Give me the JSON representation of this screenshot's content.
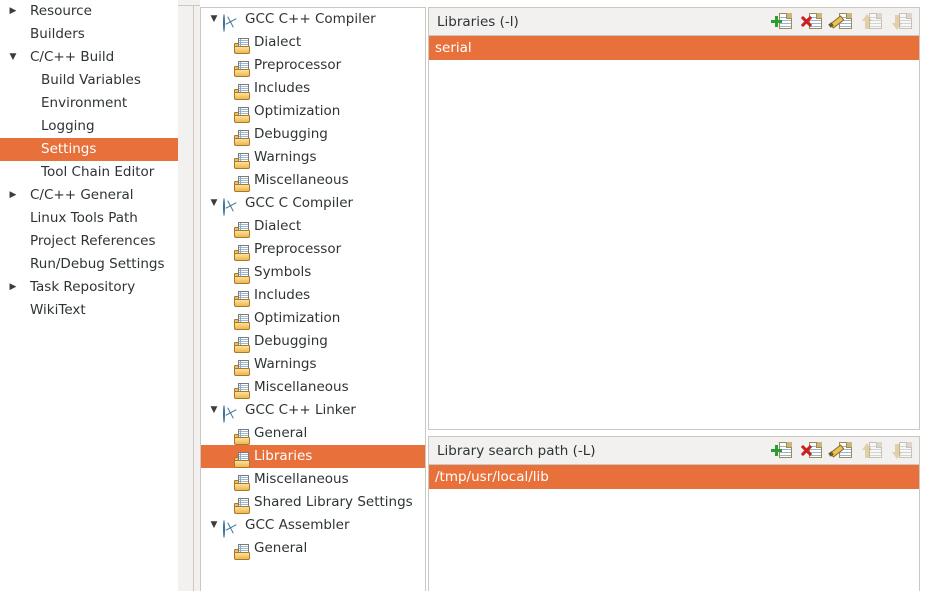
{
  "accent_color": "#e8703a",
  "sidebar": {
    "items": [
      {
        "label": "Resource",
        "level": 0,
        "arrow": "collapsed",
        "selected": false
      },
      {
        "label": "Builders",
        "level": 0,
        "arrow": "none",
        "selected": false
      },
      {
        "label": "C/C++ Build",
        "level": 0,
        "arrow": "expanded",
        "selected": false
      },
      {
        "label": "Build Variables",
        "level": 1,
        "arrow": "none",
        "selected": false
      },
      {
        "label": "Environment",
        "level": 1,
        "arrow": "none",
        "selected": false
      },
      {
        "label": "Logging",
        "level": 1,
        "arrow": "none",
        "selected": false
      },
      {
        "label": "Settings",
        "level": 1,
        "arrow": "none",
        "selected": true
      },
      {
        "label": "Tool Chain Editor",
        "level": 1,
        "arrow": "none",
        "selected": false
      },
      {
        "label": "C/C++ General",
        "level": 0,
        "arrow": "collapsed",
        "selected": false
      },
      {
        "label": "Linux Tools Path",
        "level": 0,
        "arrow": "none",
        "selected": false
      },
      {
        "label": "Project References",
        "level": 0,
        "arrow": "none",
        "selected": false
      },
      {
        "label": "Run/Debug Settings",
        "level": 0,
        "arrow": "none",
        "selected": false
      },
      {
        "label": "Task Repository",
        "level": 0,
        "arrow": "collapsed",
        "selected": false
      },
      {
        "label": "WikiText",
        "level": 0,
        "arrow": "none",
        "selected": false
      }
    ]
  },
  "tool_tree": {
    "rows": [
      {
        "label": "GCC C++ Compiler",
        "kind": "parent",
        "icon": "tool-icon",
        "selected": false
      },
      {
        "label": "Dialect",
        "kind": "child",
        "icon": "folder-icon",
        "selected": false
      },
      {
        "label": "Preprocessor",
        "kind": "child",
        "icon": "folder-icon",
        "selected": false
      },
      {
        "label": "Includes",
        "kind": "child",
        "icon": "folder-icon",
        "selected": false
      },
      {
        "label": "Optimization",
        "kind": "child",
        "icon": "folder-icon",
        "selected": false
      },
      {
        "label": "Debugging",
        "kind": "child",
        "icon": "folder-icon",
        "selected": false
      },
      {
        "label": "Warnings",
        "kind": "child",
        "icon": "folder-icon",
        "selected": false
      },
      {
        "label": "Miscellaneous",
        "kind": "child",
        "icon": "folder-icon",
        "selected": false
      },
      {
        "label": "GCC C Compiler",
        "kind": "parent",
        "icon": "tool-icon",
        "selected": false
      },
      {
        "label": "Dialect",
        "kind": "child",
        "icon": "folder-icon",
        "selected": false
      },
      {
        "label": "Preprocessor",
        "kind": "child",
        "icon": "folder-icon",
        "selected": false
      },
      {
        "label": "Symbols",
        "kind": "child",
        "icon": "folder-icon",
        "selected": false
      },
      {
        "label": "Includes",
        "kind": "child",
        "icon": "folder-icon",
        "selected": false
      },
      {
        "label": "Optimization",
        "kind": "child",
        "icon": "folder-icon",
        "selected": false
      },
      {
        "label": "Debugging",
        "kind": "child",
        "icon": "folder-icon",
        "selected": false
      },
      {
        "label": "Warnings",
        "kind": "child",
        "icon": "folder-icon",
        "selected": false
      },
      {
        "label": "Miscellaneous",
        "kind": "child",
        "icon": "folder-icon",
        "selected": false
      },
      {
        "label": "GCC C++ Linker",
        "kind": "parent",
        "icon": "tool-icon",
        "selected": false
      },
      {
        "label": "General",
        "kind": "child",
        "icon": "folder-icon",
        "selected": false
      },
      {
        "label": "Libraries",
        "kind": "child",
        "icon": "folder-icon",
        "selected": true
      },
      {
        "label": "Miscellaneous",
        "kind": "child",
        "icon": "folder-icon",
        "selected": false
      },
      {
        "label": "Shared Library Settings",
        "kind": "child",
        "icon": "folder-icon",
        "selected": false
      },
      {
        "label": "GCC Assembler",
        "kind": "parent",
        "icon": "tool-icon",
        "selected": false
      },
      {
        "label": "General",
        "kind": "child",
        "icon": "folder-icon",
        "selected": false
      }
    ]
  },
  "libraries_panel": {
    "title": "Libraries (-l)",
    "tools": [
      {
        "name": "add-icon",
        "enabled": true
      },
      {
        "name": "delete-icon",
        "enabled": true
      },
      {
        "name": "edit-icon",
        "enabled": true
      },
      {
        "name": "move-up-icon",
        "enabled": false
      },
      {
        "name": "move-down-icon",
        "enabled": false
      }
    ],
    "entries": [
      {
        "value": "serial",
        "selected": true
      }
    ]
  },
  "search_path_panel": {
    "title": "Library search path (-L)",
    "tools": [
      {
        "name": "add-icon",
        "enabled": true
      },
      {
        "name": "delete-icon",
        "enabled": true
      },
      {
        "name": "edit-icon",
        "enabled": true
      },
      {
        "name": "move-up-icon",
        "enabled": false
      },
      {
        "name": "move-down-icon",
        "enabled": false
      }
    ],
    "entries": [
      {
        "value": "/tmp/usr/local/lib",
        "selected": true
      }
    ]
  }
}
